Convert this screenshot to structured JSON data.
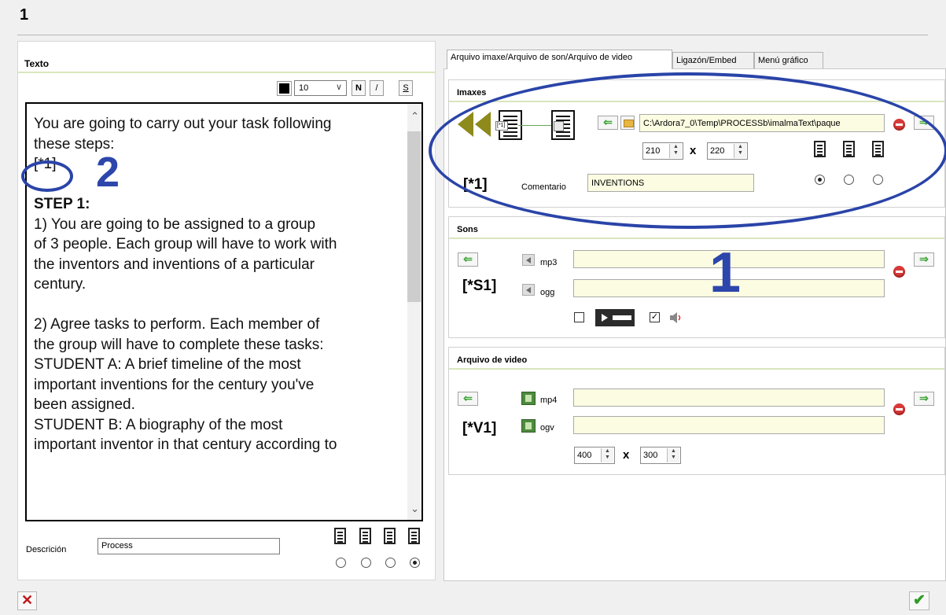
{
  "window": {
    "title": "1"
  },
  "left_panel": {
    "header": "Texto",
    "font_size": "10",
    "bold_label": "N",
    "italic_label": "/",
    "underline_label": "S",
    "text_lines": [
      "You are going to carry out your task following",
      "these steps:",
      "[*1]",
      "",
      "STEP 1:",
      "1)  You are going to be assigned to a group",
      "of 3 people. Each group will have to work with",
      "the inventors and inventions of a particular",
      "century.",
      "",
      "2)   Agree tasks to perform. Each member of",
      "the group will have to complete these tasks:",
      "STUDENT A: A brief timeline of the most",
      "important inventions for the century you've",
      "been assigned.",
      "STUDENT B: A biography of the most",
      "important inventor in that century according to"
    ],
    "description_label": "Descrición",
    "description_value": "Process"
  },
  "annotations": {
    "two": "2",
    "one": "1"
  },
  "tabs": [
    {
      "label": "Arquivo imaxe/Arquivo de son/Arquivo de video",
      "active": true
    },
    {
      "label": "Ligazón/Embed",
      "active": false
    },
    {
      "label": "Menú gráfico",
      "active": false
    }
  ],
  "images": {
    "title": "Imaxes",
    "path": "C:\\Ardora7_0\\Temp\\PROCESSb\\imalmaText\\paque",
    "width": "210",
    "height": "220",
    "times": "x",
    "tag": "[*1]",
    "thumb_tag": "[*1]",
    "comment_label": "Comentario",
    "comment_value": "INVENTIONS"
  },
  "sounds": {
    "title": "Sons",
    "tag": "[*S1]",
    "mp3_label": "mp3",
    "ogg_label": "ogg",
    "mp3_value": "",
    "ogg_value": ""
  },
  "video": {
    "title": "Arquivo de video",
    "tag": "[*V1]",
    "mp4_label": "mp4",
    "ogv_label": "ogv",
    "mp4_value": "",
    "ogv_value": "",
    "width": "400",
    "height": "300",
    "times": "x"
  },
  "colors": {
    "accent_line": "#d9e6bd",
    "field_bg": "#fcfce2",
    "annotation": "#2a44a8"
  }
}
